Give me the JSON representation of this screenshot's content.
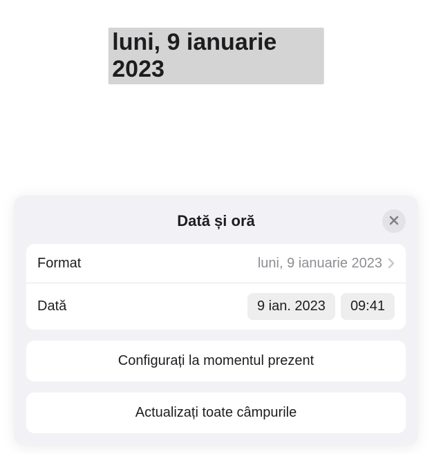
{
  "document": {
    "selected_text": "luni, 9 ianuarie 2023"
  },
  "sheet": {
    "title": "Dată și oră",
    "rows": {
      "format": {
        "label": "Format",
        "value": "luni, 9 ianuarie 2023"
      },
      "date": {
        "label": "Dată",
        "date_value": "9 ian. 2023",
        "time_value": "09:41"
      }
    },
    "actions": {
      "set_now": "Configurați la momentul prezent",
      "update_all": "Actualizați toate câmpurile"
    }
  }
}
